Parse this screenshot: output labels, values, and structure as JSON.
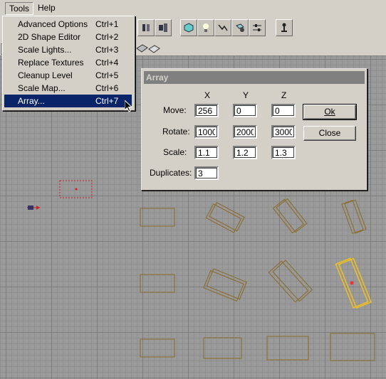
{
  "menubar": {
    "tools": "Tools",
    "help": "Help"
  },
  "tools_menu": [
    {
      "label": "Advanced Options",
      "shortcut": "Ctrl+1"
    },
    {
      "label": "2D Shape Editor",
      "shortcut": "Ctrl+2"
    },
    {
      "label": "Scale Lights...",
      "shortcut": "Ctrl+3"
    },
    {
      "label": "Replace Textures",
      "shortcut": "Ctrl+4"
    },
    {
      "label": "Cleanup Level",
      "shortcut": "Ctrl+5"
    },
    {
      "label": "Scale Map...",
      "shortcut": "Ctrl+6"
    },
    {
      "label": "Array...",
      "shortcut": "Ctrl+7",
      "selected": true
    }
  ],
  "array_dialog": {
    "title": "Array",
    "columns": {
      "x": "X",
      "y": "Y",
      "z": "Z"
    },
    "rows": {
      "move": {
        "label": "Move:",
        "x": "256",
        "y": "0",
        "z": "0"
      },
      "rotate": {
        "label": "Rotate:",
        "x": "1000",
        "y": "2000",
        "z": "3000"
      },
      "scale": {
        "label": "Scale:",
        "x": "1.1",
        "y": "1.2",
        "z": "1.3"
      }
    },
    "duplicates": {
      "label": "Duplicates:",
      "value": "3"
    },
    "ok_label": "Ok",
    "close_label": "Close"
  },
  "toolbar": {
    "icons": [
      "layout-icon",
      "layout2-icon",
      "cube-icon",
      "light-icon",
      "path-icon",
      "mover-icon",
      "sliders-icon",
      "actor-icon"
    ]
  },
  "colors": {
    "selected_menu": "#0a246a",
    "brush_outline": "#8a6a2a",
    "selected_brush": "#f0c020",
    "viewport_bg": "#9a9a9a"
  }
}
